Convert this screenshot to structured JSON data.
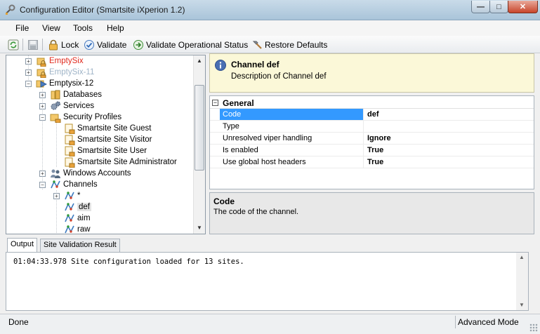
{
  "window": {
    "title": "Configuration Editor (Smartsite iXperion 1.2)",
    "controls": {
      "minimize": "—",
      "maximize": "□",
      "close": "✕"
    }
  },
  "menu": [
    "File",
    "View",
    "Tools",
    "Help"
  ],
  "toolbar": {
    "lock": "Lock",
    "validate": "Validate",
    "validate_operational": "Validate Operational Status",
    "restore_defaults": "Restore Defaults"
  },
  "tree": {
    "empty_six": "EmptySix",
    "empty_six_11": "EmptySix-11",
    "empty_six_12": "Emptysix-12",
    "databases": "Databases",
    "services": "Services",
    "security_profiles": "Security Profiles",
    "guest": "Smartsite Site Guest",
    "visitor": "Smartsite Site Visitor",
    "user": "Smartsite Site User",
    "administrator": "Smartsite Site Administrator",
    "windows_accounts": "Windows Accounts",
    "channels": "Channels",
    "channel_star": "*",
    "channel_def": "def",
    "channel_aim": "aim",
    "channel_raw": "raw"
  },
  "header": {
    "title": "Channel def",
    "description": "Description of Channel def"
  },
  "properties": {
    "category": "General",
    "rows": [
      {
        "name": "Code",
        "value": "def"
      },
      {
        "name": "Type",
        "value": ""
      },
      {
        "name": "Unresolved viper handling",
        "value": "Ignore"
      },
      {
        "name": "Is enabled",
        "value": "True"
      },
      {
        "name": "Use global host headers",
        "value": "True"
      }
    ]
  },
  "help": {
    "title": "Code",
    "description": "The code of the channel."
  },
  "tabs": {
    "output": "Output",
    "validation": "Site Validation Result"
  },
  "output": {
    "line": "01:04:33.978 Site configuration loaded for 13 sites."
  },
  "status": {
    "left": "Done",
    "right": "Advanced Mode"
  },
  "colors": {
    "selection": "#3399ff",
    "header_bg": "#fbf8d8",
    "error_text": "#e0281c",
    "disabled_text": "#9fb4c7"
  }
}
